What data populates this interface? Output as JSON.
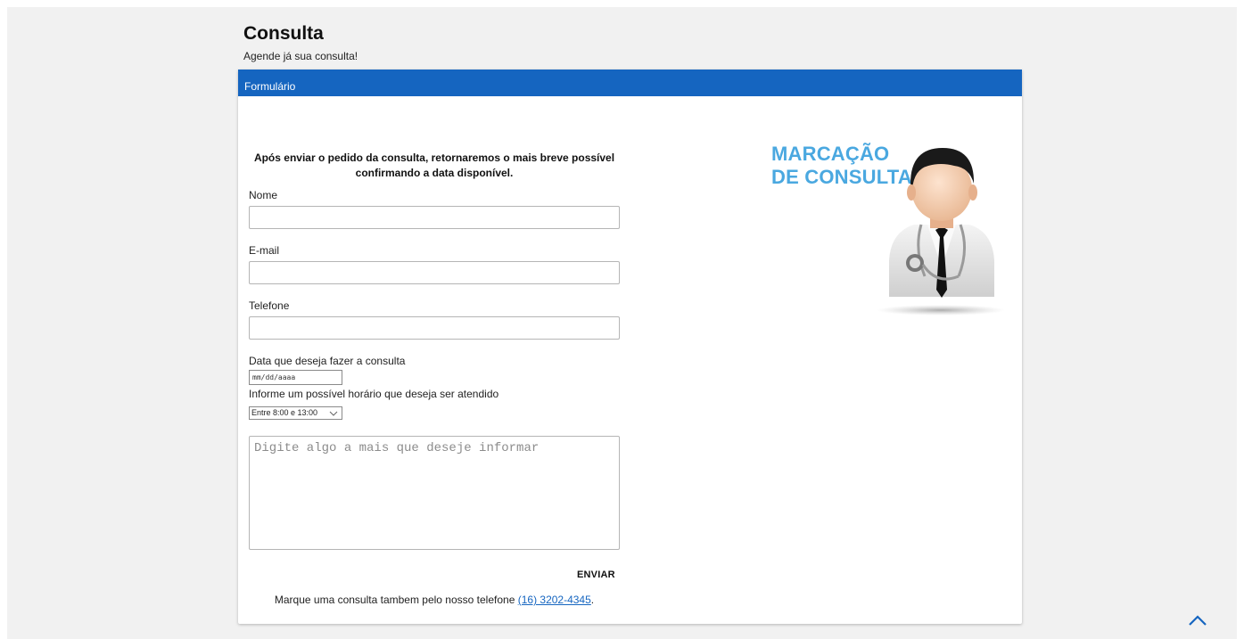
{
  "header": {
    "title": "Consulta",
    "subtitle": "Agende já sua consulta!"
  },
  "card": {
    "header_label": "Formulário",
    "intro_line1": "Após enviar o pedido da consulta, retornaremos o mais breve possível",
    "intro_line2": "confirmando a data disponível."
  },
  "form": {
    "name_label": "Nome",
    "email_label": "E-mail",
    "phone_label": "Telefone",
    "date_label": "Data que deseja fazer a consulta",
    "date_placeholder": "mm/dd/aaaa",
    "time_label": "Informe um possível horário que deseja ser atendido",
    "time_selected": "Entre 8:00 e 13:00",
    "notes_placeholder": "Digite algo a mais que deseje informar",
    "send_label": "ENVIAR"
  },
  "footer": {
    "note_text": "Marque uma consulta tambem pelo nosso telefone",
    "phone_link": "(16) 3202-4345",
    "period": "."
  },
  "promo": {
    "line1": "MARCAÇÃO",
    "line2": "DE CONSULTA"
  },
  "colors": {
    "accent": "#1565c0",
    "promo_text": "#4aa8e0",
    "background": "#f1f1f1"
  },
  "icons": {
    "scroll_top": "chevron-up-icon",
    "doctor": "doctor-illustration"
  }
}
